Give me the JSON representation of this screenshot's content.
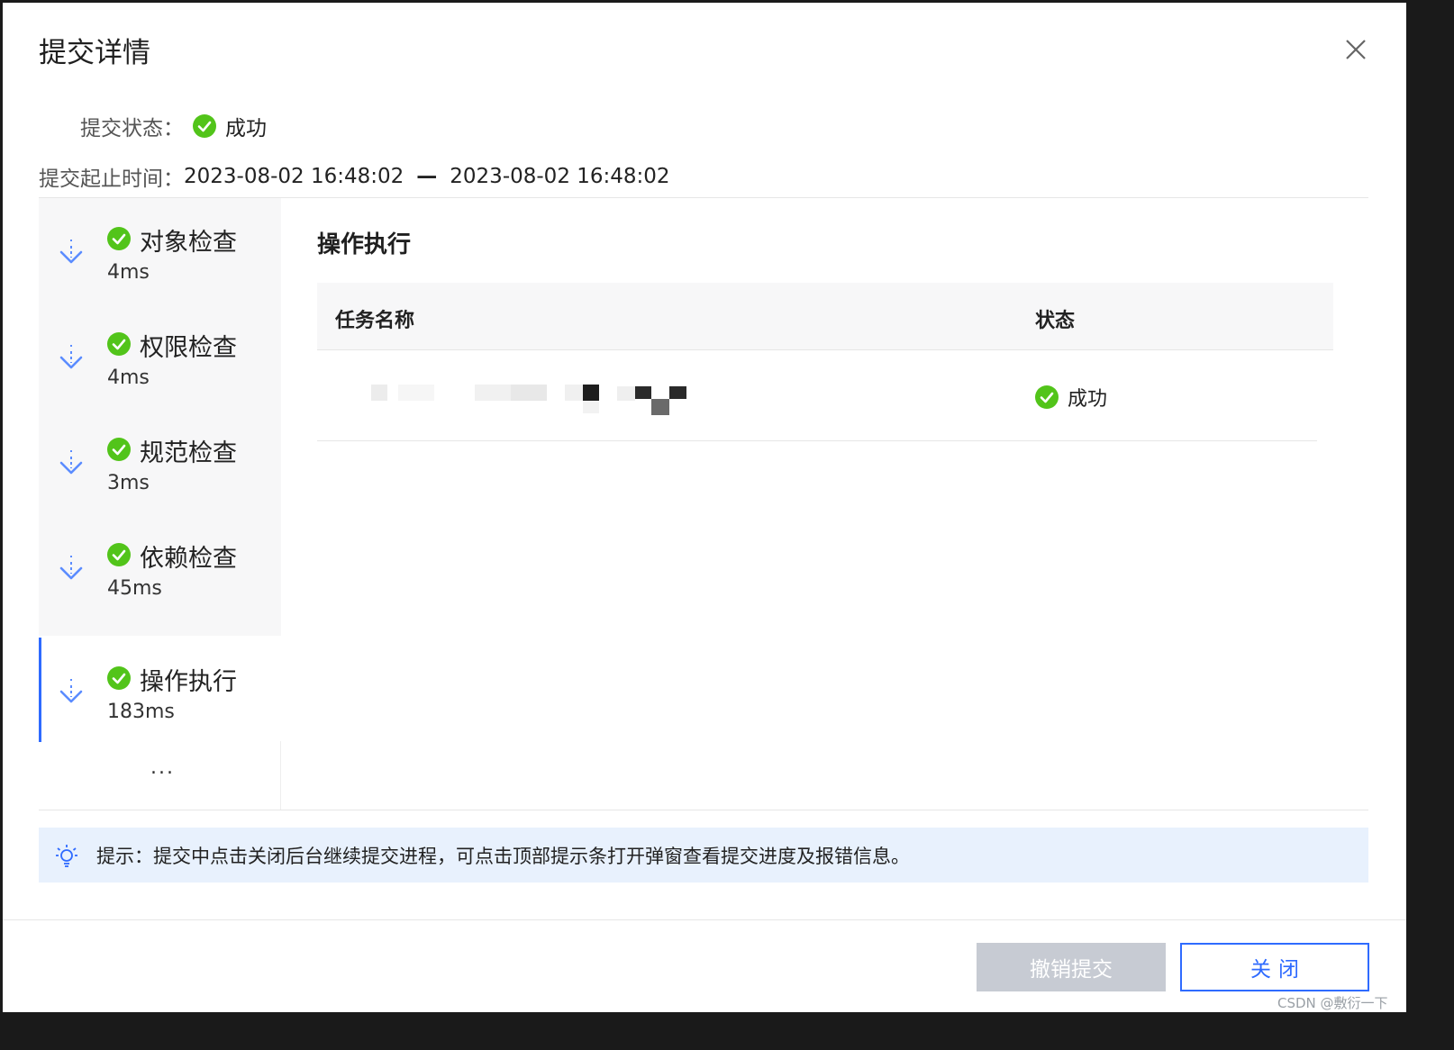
{
  "dialog": {
    "title": "提交详情",
    "close_icon": "close-icon"
  },
  "status": {
    "label": "提交状态：",
    "value": "成功"
  },
  "time": {
    "label": "提交起止时间：",
    "start": "2023-08-02 16:48:02",
    "separator": "—",
    "end": "2023-08-02 16:48:02"
  },
  "steps": [
    {
      "name": "对象检查",
      "duration": "4ms"
    },
    {
      "name": "权限检查",
      "duration": "4ms"
    },
    {
      "name": "规范检查",
      "duration": "3ms"
    },
    {
      "name": "依赖检查",
      "duration": "45ms"
    },
    {
      "name": "操作执行",
      "duration": "183ms"
    }
  ],
  "steps_more": "...",
  "content": {
    "title": "操作执行",
    "table": {
      "headers": [
        "任务名称",
        "状态"
      ],
      "rows": [
        {
          "status": "成功"
        }
      ]
    }
  },
  "tip": {
    "text": "提示：提交中点击关闭后台继续提交进程，可点击顶部提示条打开弹窗查看提交进度及报错信息。"
  },
  "buttons": {
    "revoke": "撤销提交",
    "close": "关闭"
  },
  "credit": "CSDN @敷衍一下",
  "colors": {
    "success": "#52c41a",
    "primary": "#2f6bff",
    "tip_bg": "#e8f1fd",
    "disabled_btn": "#c7cbd3"
  }
}
